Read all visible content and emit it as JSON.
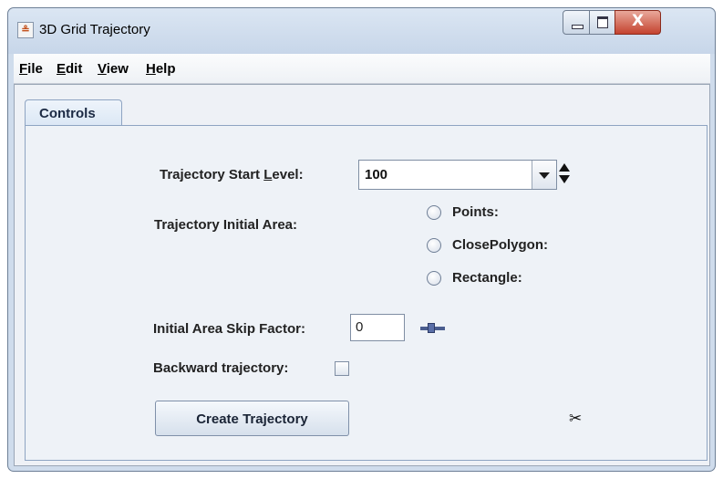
{
  "window": {
    "title": "3D Grid Trajectory",
    "app_icon_glyph": "≗",
    "minimize_icon": "minimize-icon",
    "maximize_icon": "maximize-icon",
    "close_glyph": "X"
  },
  "menu": [
    "File",
    "Edit",
    "View",
    "Help"
  ],
  "tabs": [
    {
      "label": "Controls"
    }
  ],
  "controls": {
    "start_level_label_pre": "Trajectory Start ",
    "start_level_label_ul": "L",
    "start_level_label_post": "evel:",
    "start_level_value": "100",
    "initial_area_label": "Trajectory Initial Area:",
    "radio_options": [
      "Points:",
      "ClosePolygon:",
      "Rectangle:"
    ],
    "skip_factor_label": "Initial Area Skip Factor:",
    "skip_factor_value": "0",
    "backward_label": "Backward trajectory:",
    "backward_checked": false,
    "create_button": "Create Trajectory"
  },
  "icons": {
    "spinner": "up-down-spinner-icon",
    "slider": "slider-icon",
    "scissors": "✂"
  }
}
